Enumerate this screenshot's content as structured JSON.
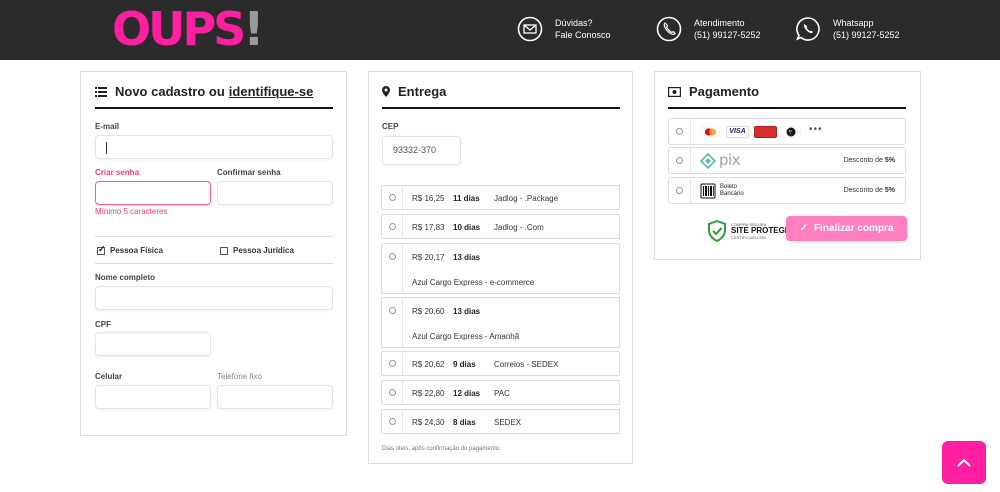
{
  "header": {
    "logo_text": "OUPS",
    "logo_bang": "!",
    "duvidas": {
      "icon": "mail-icon",
      "line1": "Dúvidas?",
      "line2": "Fale Conosco"
    },
    "atendimento": {
      "icon": "phone-icon",
      "line1": "Atendimento",
      "line2": "(51) 99127-5252"
    },
    "whatsapp": {
      "icon": "whatsapp-icon",
      "line1": "Whatsapp",
      "line2": "(51) 99127-5252"
    }
  },
  "cadastro": {
    "title_prefix": "Novo cadastro ou",
    "title_link": "identifique-se",
    "email_label": "E-mail",
    "email_value": "",
    "senha_label": "Criar senha",
    "senha_hint": "Mínimo 5 caracteres",
    "confirmar_label": "Confirmar senha",
    "pessoa_fisica": "Pessoa Física",
    "pessoa_juridica": "Pessoa Jurídica",
    "nome_label": "Nome completo",
    "cpf_label": "CPF",
    "celular_label": "Celular",
    "telefone_label": "Telefone fixo"
  },
  "entrega": {
    "title": "Entrega",
    "cep_label": "CEP",
    "cep_value": "93332-370",
    "options": [
      {
        "price": "R$ 16,25",
        "days": "11 dias",
        "carrier": "Jadlog - .Package"
      },
      {
        "price": "R$ 17,83",
        "days": "10 dias",
        "carrier": "Jadlog - .Com"
      },
      {
        "price": "R$ 20,17",
        "days": "13 dias",
        "carrier": "Azul Cargo Express - e-commerce"
      },
      {
        "price": "R$ 20,60",
        "days": "13 dias",
        "carrier": "Azul Cargo Express - Amanhã"
      },
      {
        "price": "R$ 20,62",
        "days": "9 dias",
        "carrier": "Correios - SEDEX"
      },
      {
        "price": "R$ 22,80",
        "days": "12 dias",
        "carrier": "PAC"
      },
      {
        "price": "R$ 24,30",
        "days": "8 dias",
        "carrier": "SEDEX"
      }
    ],
    "note": "Dias úteis, após confirmação do pagamento."
  },
  "pagamento": {
    "title": "Pagamento",
    "card_visa": "VISA",
    "card_more": "•••",
    "pix_label": "pix",
    "pix_discount_prefix": "Desconto de",
    "pix_discount_value": "5%",
    "boleto_line1": "Boleto",
    "boleto_line2": "Bancário",
    "boleto_discount_prefix": "Desconto de",
    "boleto_discount_value": "5%",
    "seal_line1": "COMPRA SEGURA",
    "seal_line2": "SITE PROTEGIDO",
    "seal_line3": "CERTIFICADO SSL",
    "finalizar_label": "Finalizar compra"
  },
  "colors": {
    "brand": "#ff1fa0",
    "header_bg": "#2b2b2b",
    "button": "#ff7fbf",
    "error": "#e8417d"
  }
}
